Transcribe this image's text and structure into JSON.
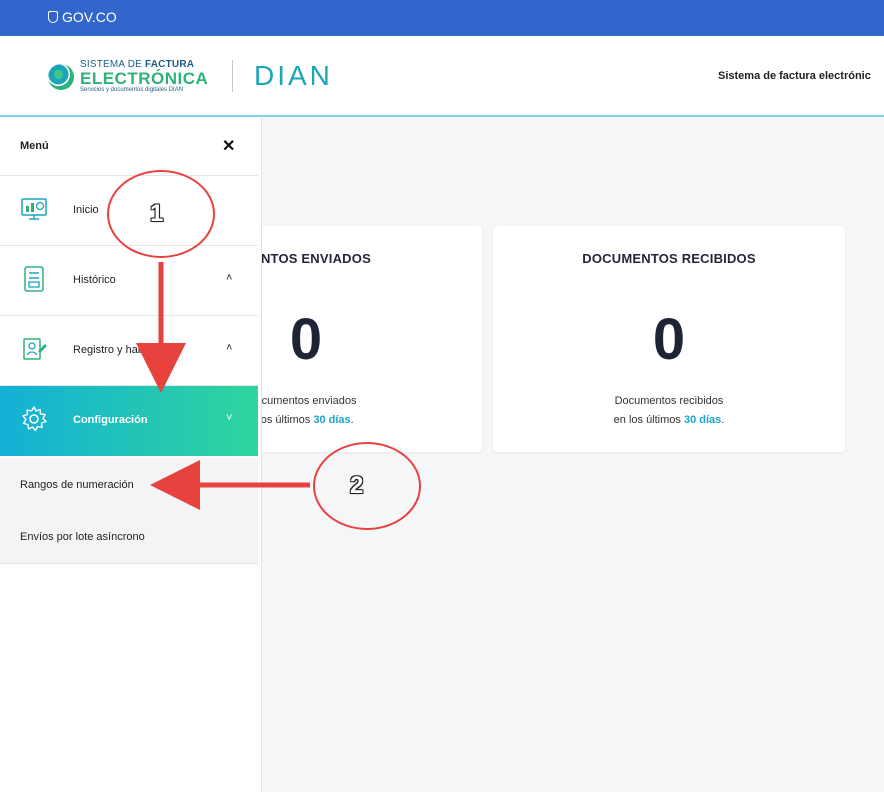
{
  "gov_bar": {
    "label": "GOV.CO"
  },
  "header": {
    "logo_line1_a": "SISTEMA DE ",
    "logo_line1_b": "FACTURA",
    "logo_line2": "ELECTRÓNICA",
    "logo_line3": "Servicios y documentos digitales DIAN",
    "dian_logo": "DIAN",
    "title": "Sistema de factura electrónic"
  },
  "menu": {
    "title": "Menú",
    "close_icon": "close-icon",
    "items": [
      {
        "label": "Inicio",
        "icon": "dashboard-icon",
        "chevron": ""
      },
      {
        "label": "Histórico",
        "icon": "document-list-icon",
        "chevron": "˄"
      },
      {
        "label": "Registro y habilitación",
        "icon": "registration-icon",
        "chevron": "˄"
      },
      {
        "label": "Configuración",
        "icon": "gear-icon",
        "chevron": "˅"
      }
    ],
    "submenu": [
      {
        "label": "Rangos de numeración"
      },
      {
        "label": "Envíos por lote asíncrono"
      }
    ]
  },
  "cards": [
    {
      "title": "MENTOS ENVIADOS",
      "value": "0",
      "line1": "ocumentos enviados",
      "line2_prefix": "los últimos ",
      "line2_highlight": "30 días",
      "line2_suffix": "."
    },
    {
      "title": "DOCUMENTOS RECIBIDOS",
      "value": "0",
      "line1": "Documentos recibidos",
      "line2_prefix": "en los últimos ",
      "line2_highlight": "30 días",
      "line2_suffix": "."
    }
  ],
  "annotations": {
    "step1": "1",
    "step2": "2",
    "color": "#e8423f"
  }
}
